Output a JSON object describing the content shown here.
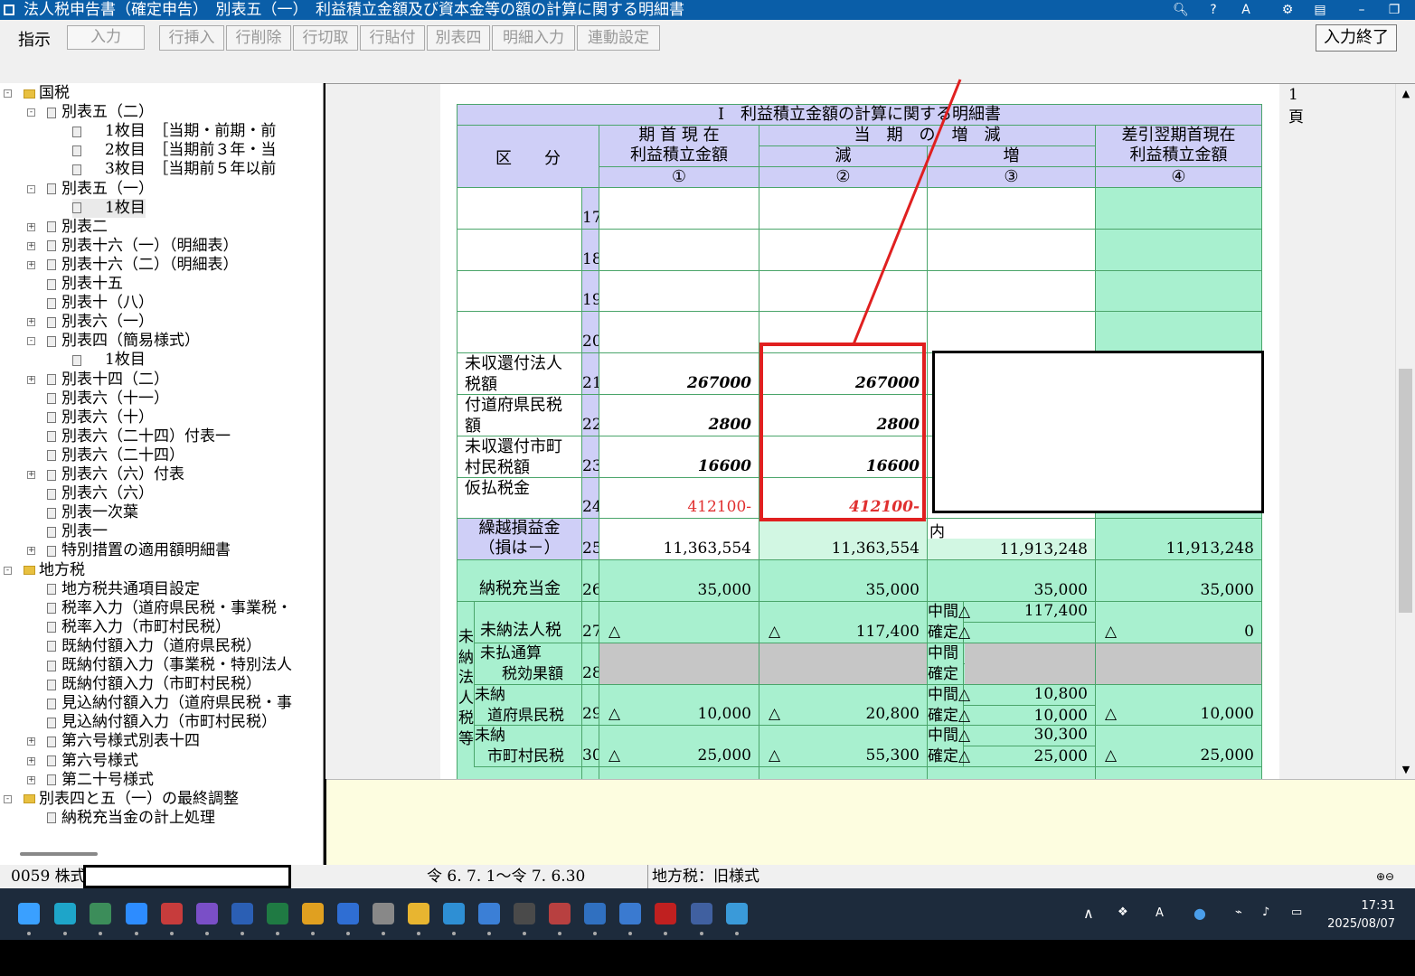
{
  "title": "法人税申告書（確定申告）　別表五（一）　利益積立金額及び資本金等の額の計算に関する明細書",
  "toolbar": {
    "label": "指示",
    "mode": "入力",
    "buttons": [
      "行挿入",
      "行削除",
      "行切取",
      "行貼付",
      "別表四",
      "明細入力",
      "連動設定"
    ],
    "end_button": "入力終了"
  },
  "tree": [
    {
      "label": "国税",
      "kind": "folder",
      "exp": "-"
    },
    {
      "label": "別表五（二）",
      "kind": "book",
      "exp": "-"
    },
    {
      "label": "1枚目　［当期・前期・前",
      "kind": "doc"
    },
    {
      "label": "2枚目　［当期前３年・当",
      "kind": "doc"
    },
    {
      "label": "3枚目　［当期前５年以前",
      "kind": "doc"
    },
    {
      "label": "別表五（一）",
      "kind": "book",
      "exp": "-"
    },
    {
      "label": "1枚目",
      "kind": "doc",
      "selected": true
    },
    {
      "label": "別表二",
      "kind": "book",
      "exp": "+"
    },
    {
      "label": "別表十六（一）（明細表）",
      "kind": "book",
      "exp": "+"
    },
    {
      "label": "別表十六（二）（明細表）",
      "kind": "book",
      "exp": "+"
    },
    {
      "label": "別表十五",
      "kind": "book"
    },
    {
      "label": "別表十（八）",
      "kind": "book"
    },
    {
      "label": "別表六（一）",
      "kind": "book",
      "exp": "+"
    },
    {
      "label": "別表四（簡易様式）",
      "kind": "book",
      "exp": "-"
    },
    {
      "label": "1枚目",
      "kind": "doc"
    },
    {
      "label": "別表十四（二）",
      "kind": "book",
      "exp": "+"
    },
    {
      "label": "別表六（十一）",
      "kind": "book"
    },
    {
      "label": "別表六（十）",
      "kind": "book"
    },
    {
      "label": "別表六（二十四）付表一",
      "kind": "book"
    },
    {
      "label": "別表六（二十四）",
      "kind": "book"
    },
    {
      "label": "別表六（六）付表",
      "kind": "book",
      "exp": "+"
    },
    {
      "label": "別表六（六）",
      "kind": "book"
    },
    {
      "label": "別表一次葉",
      "kind": "book"
    },
    {
      "label": "別表一",
      "kind": "book"
    },
    {
      "label": "特別措置の適用額明細書",
      "kind": "book",
      "exp": "+"
    },
    {
      "label": "地方税",
      "kind": "folder",
      "exp": "-"
    },
    {
      "label": "地方税共通項目設定",
      "kind": "book"
    },
    {
      "label": "税率入力（道府県民税・事業税・",
      "kind": "book"
    },
    {
      "label": "税率入力（市町村民税）",
      "kind": "book"
    },
    {
      "label": "既納付額入力（道府県民税）",
      "kind": "book"
    },
    {
      "label": "既納付額入力（事業税・特別法人",
      "kind": "book"
    },
    {
      "label": "既納付額入力（市町村民税）",
      "kind": "book"
    },
    {
      "label": "見込納付額入力（道府県民税・事",
      "kind": "book"
    },
    {
      "label": "見込納付額入力（市町村民税）",
      "kind": "book"
    },
    {
      "label": "第六号様式別表十四",
      "kind": "book",
      "exp": "+"
    },
    {
      "label": "第六号様式",
      "kind": "book",
      "exp": "+"
    },
    {
      "label": "第二十号様式",
      "kind": "book",
      "exp": "+"
    },
    {
      "label": "別表四と五（一）の最終調整",
      "kind": "folder",
      "exp": "-"
    },
    {
      "label": "納税充当金の計上処理",
      "kind": "book"
    }
  ],
  "sheet": {
    "page": "1頁",
    "heading": "Ⅰ　利益積立金額の計算に関する明細書",
    "col_kubun": "区　　分",
    "col1": "期 首 現 在\n利益積立金額",
    "col_period": "当　期　の　増　減",
    "col2": "減",
    "col3": "増",
    "col4": "差引翌期首現在\n利益積立金額",
    "circ1": "①",
    "circ2": "②",
    "circ3": "③",
    "circ4": "④",
    "rows": {
      "r17": "17",
      "r18": "18",
      "r19": "19",
      "r20": "20",
      "r21": {
        "no": "21",
        "label": "未収還付法人\n税額",
        "c1": "267000",
        "c2": "267000"
      },
      "r22": {
        "no": "22",
        "label": "付道府県民税\n額",
        "c1": "2800",
        "c2": "2800"
      },
      "r23": {
        "no": "23",
        "label": "未収還付市町\n村民税額",
        "c1": "16600",
        "c2": "16600"
      },
      "r24": {
        "no": "24",
        "label": "仮払税金",
        "c1": "412100-",
        "c2": "412100-"
      },
      "r25": {
        "no": "25",
        "label": "繰越損益金\n（損は－）",
        "c1": "11,363,554",
        "c2": "11,363,554",
        "c3_note": "内",
        "c3": "11,913,248",
        "c4": "11,913,248"
      },
      "r26": {
        "no": "26",
        "label": "納税充当金",
        "c1": "35,000",
        "c2": "35,000",
        "c3": "35,000",
        "c4": "35,000"
      },
      "r27": {
        "no": "27",
        "label": "未納法人税",
        "tri": "△",
        "c2": "117,400",
        "mid_label": "中間△",
        "mid": "117,400",
        "fix_label": "確定△",
        "c4": "0"
      },
      "r28": {
        "no": "28",
        "label1": "未払通算",
        "label2": "税効果額",
        "mid_label": "中間",
        "fix_label": "確定"
      },
      "r29": {
        "no": "29",
        "label1": "未納",
        "label2": "道府県民税",
        "c1": "10,000",
        "c2": "20,800",
        "mid_label": "中間△",
        "mid": "10,800",
        "fix_label": "確定△",
        "fix": "10,000",
        "c4": "10,000"
      },
      "r30": {
        "no": "30",
        "label1": "未納",
        "label2": "市町村民税",
        "c1": "25,000",
        "c2": "55,300",
        "mid_label": "中間△",
        "mid": "30,300",
        "fix_label": "確定△",
        "fix": "25,000",
        "c4": "25,000"
      }
    },
    "side_label": [
      "未",
      "納",
      "法",
      "人",
      "税",
      "等"
    ],
    "tri": "△"
  },
  "status": {
    "code": "0059 株式",
    "period": "令 6. 7. 1～令 7. 6.30",
    "local_tax": "地方税：旧様式"
  },
  "taskbar": {
    "clock_time": "17:31",
    "clock_date": "2025/08/07",
    "ime": "A"
  },
  "colors": {
    "title_blue": "#0a5ea8",
    "header_lavender": "#cfcff7",
    "cell_green": "#a8f0cf",
    "annotation_red": "#e02020",
    "taskbar": "#1d2b3c"
  }
}
